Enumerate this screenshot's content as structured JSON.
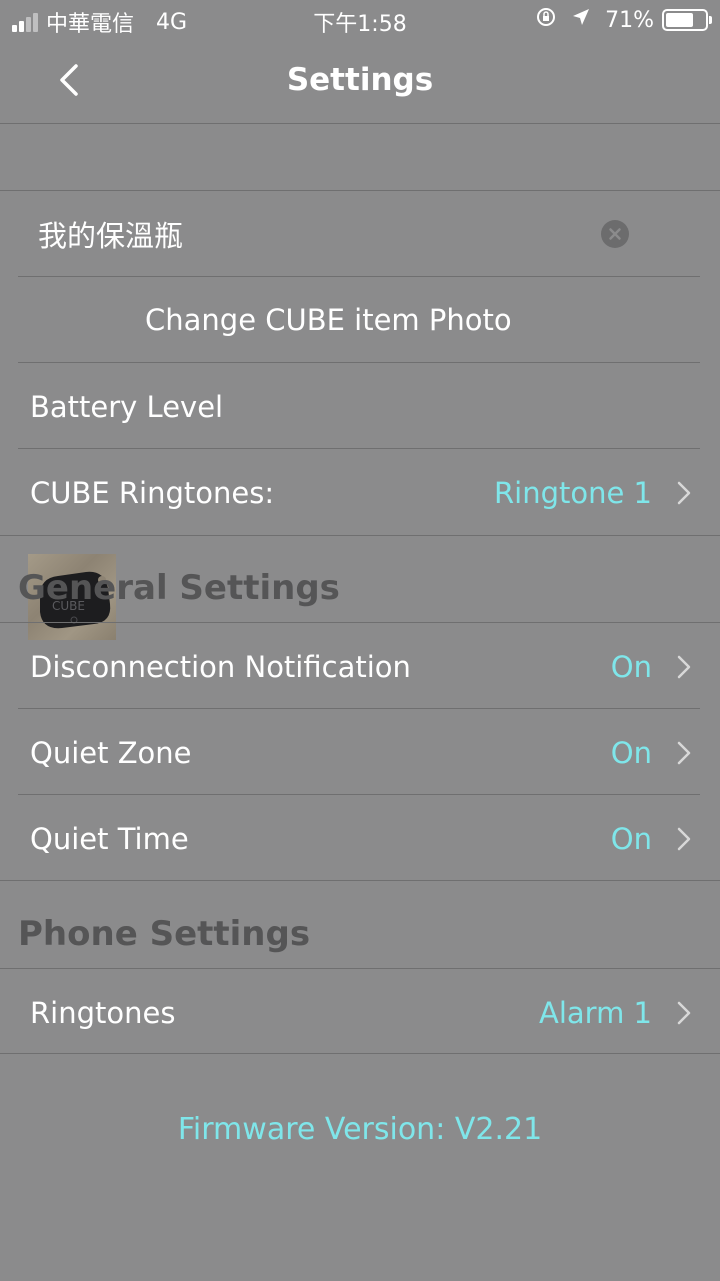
{
  "status_bar": {
    "carrier": "中華電信",
    "network": "4G",
    "time": "下午1:58",
    "battery_percent": "71%",
    "battery_level": 0.71
  },
  "nav": {
    "title": "Settings",
    "back_icon": "chevron-left-icon"
  },
  "item": {
    "name_value": "我的保溫瓶",
    "clear_icon": "clear-icon",
    "photo_label": "Change CUBE item Photo",
    "photo_text": "CUBE",
    "battery_label": "Battery Level",
    "ringtones_label": "CUBE Ringtones:",
    "ringtones_value": "Ringtone 1"
  },
  "general": {
    "header": "General Settings",
    "disconnection_label": "Disconnection Notification",
    "disconnection_value": "On",
    "quiet_zone_label": "Quiet Zone",
    "quiet_zone_value": "On",
    "quiet_time_label": "Quiet Time",
    "quiet_time_value": "On"
  },
  "phone": {
    "header": "Phone Settings",
    "ringtones_label": "Ringtones",
    "ringtones_value": "Alarm 1"
  },
  "footer": {
    "firmware": "Firmware Version: V2.21"
  },
  "colors": {
    "background": "#8b8b8c",
    "accent": "#7fe6ea",
    "section_header": "#555556",
    "divider": "#6f6f70"
  }
}
